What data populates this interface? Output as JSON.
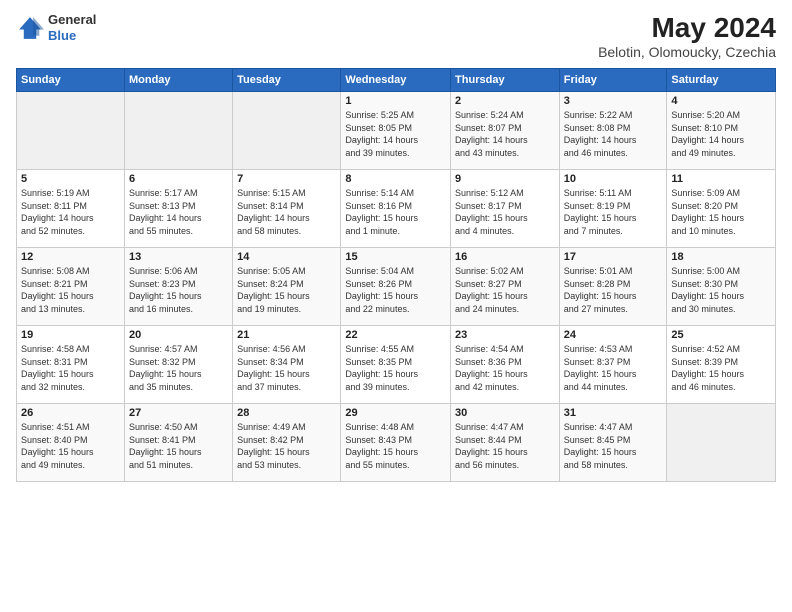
{
  "header": {
    "logo_general": "General",
    "logo_blue": "Blue",
    "month_year": "May 2024",
    "location": "Belotin, Olomoucky, Czechia"
  },
  "days_of_week": [
    "Sunday",
    "Monday",
    "Tuesday",
    "Wednesday",
    "Thursday",
    "Friday",
    "Saturday"
  ],
  "weeks": [
    [
      {
        "day": "",
        "info": ""
      },
      {
        "day": "",
        "info": ""
      },
      {
        "day": "",
        "info": ""
      },
      {
        "day": "1",
        "info": "Sunrise: 5:25 AM\nSunset: 8:05 PM\nDaylight: 14 hours\nand 39 minutes."
      },
      {
        "day": "2",
        "info": "Sunrise: 5:24 AM\nSunset: 8:07 PM\nDaylight: 14 hours\nand 43 minutes."
      },
      {
        "day": "3",
        "info": "Sunrise: 5:22 AM\nSunset: 8:08 PM\nDaylight: 14 hours\nand 46 minutes."
      },
      {
        "day": "4",
        "info": "Sunrise: 5:20 AM\nSunset: 8:10 PM\nDaylight: 14 hours\nand 49 minutes."
      }
    ],
    [
      {
        "day": "5",
        "info": "Sunrise: 5:19 AM\nSunset: 8:11 PM\nDaylight: 14 hours\nand 52 minutes."
      },
      {
        "day": "6",
        "info": "Sunrise: 5:17 AM\nSunset: 8:13 PM\nDaylight: 14 hours\nand 55 minutes."
      },
      {
        "day": "7",
        "info": "Sunrise: 5:15 AM\nSunset: 8:14 PM\nDaylight: 14 hours\nand 58 minutes."
      },
      {
        "day": "8",
        "info": "Sunrise: 5:14 AM\nSunset: 8:16 PM\nDaylight: 15 hours\nand 1 minute."
      },
      {
        "day": "9",
        "info": "Sunrise: 5:12 AM\nSunset: 8:17 PM\nDaylight: 15 hours\nand 4 minutes."
      },
      {
        "day": "10",
        "info": "Sunrise: 5:11 AM\nSunset: 8:19 PM\nDaylight: 15 hours\nand 7 minutes."
      },
      {
        "day": "11",
        "info": "Sunrise: 5:09 AM\nSunset: 8:20 PM\nDaylight: 15 hours\nand 10 minutes."
      }
    ],
    [
      {
        "day": "12",
        "info": "Sunrise: 5:08 AM\nSunset: 8:21 PM\nDaylight: 15 hours\nand 13 minutes."
      },
      {
        "day": "13",
        "info": "Sunrise: 5:06 AM\nSunset: 8:23 PM\nDaylight: 15 hours\nand 16 minutes."
      },
      {
        "day": "14",
        "info": "Sunrise: 5:05 AM\nSunset: 8:24 PM\nDaylight: 15 hours\nand 19 minutes."
      },
      {
        "day": "15",
        "info": "Sunrise: 5:04 AM\nSunset: 8:26 PM\nDaylight: 15 hours\nand 22 minutes."
      },
      {
        "day": "16",
        "info": "Sunrise: 5:02 AM\nSunset: 8:27 PM\nDaylight: 15 hours\nand 24 minutes."
      },
      {
        "day": "17",
        "info": "Sunrise: 5:01 AM\nSunset: 8:28 PM\nDaylight: 15 hours\nand 27 minutes."
      },
      {
        "day": "18",
        "info": "Sunrise: 5:00 AM\nSunset: 8:30 PM\nDaylight: 15 hours\nand 30 minutes."
      }
    ],
    [
      {
        "day": "19",
        "info": "Sunrise: 4:58 AM\nSunset: 8:31 PM\nDaylight: 15 hours\nand 32 minutes."
      },
      {
        "day": "20",
        "info": "Sunrise: 4:57 AM\nSunset: 8:32 PM\nDaylight: 15 hours\nand 35 minutes."
      },
      {
        "day": "21",
        "info": "Sunrise: 4:56 AM\nSunset: 8:34 PM\nDaylight: 15 hours\nand 37 minutes."
      },
      {
        "day": "22",
        "info": "Sunrise: 4:55 AM\nSunset: 8:35 PM\nDaylight: 15 hours\nand 39 minutes."
      },
      {
        "day": "23",
        "info": "Sunrise: 4:54 AM\nSunset: 8:36 PM\nDaylight: 15 hours\nand 42 minutes."
      },
      {
        "day": "24",
        "info": "Sunrise: 4:53 AM\nSunset: 8:37 PM\nDaylight: 15 hours\nand 44 minutes."
      },
      {
        "day": "25",
        "info": "Sunrise: 4:52 AM\nSunset: 8:39 PM\nDaylight: 15 hours\nand 46 minutes."
      }
    ],
    [
      {
        "day": "26",
        "info": "Sunrise: 4:51 AM\nSunset: 8:40 PM\nDaylight: 15 hours\nand 49 minutes."
      },
      {
        "day": "27",
        "info": "Sunrise: 4:50 AM\nSunset: 8:41 PM\nDaylight: 15 hours\nand 51 minutes."
      },
      {
        "day": "28",
        "info": "Sunrise: 4:49 AM\nSunset: 8:42 PM\nDaylight: 15 hours\nand 53 minutes."
      },
      {
        "day": "29",
        "info": "Sunrise: 4:48 AM\nSunset: 8:43 PM\nDaylight: 15 hours\nand 55 minutes."
      },
      {
        "day": "30",
        "info": "Sunrise: 4:47 AM\nSunset: 8:44 PM\nDaylight: 15 hours\nand 56 minutes."
      },
      {
        "day": "31",
        "info": "Sunrise: 4:47 AM\nSunset: 8:45 PM\nDaylight: 15 hours\nand 58 minutes."
      },
      {
        "day": "",
        "info": ""
      }
    ]
  ]
}
